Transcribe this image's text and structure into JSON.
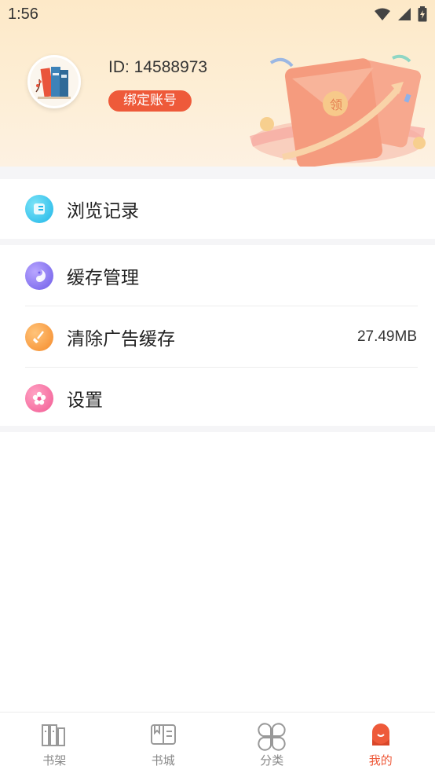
{
  "status_bar": {
    "time": "1:56"
  },
  "profile": {
    "id_text": "ID: 14588973",
    "bind_button": "绑定账号"
  },
  "menu": {
    "browse_history": {
      "label": "浏览记录"
    },
    "cache_manage": {
      "label": "缓存管理"
    },
    "clear_ad_cache": {
      "label": "清除广告缓存",
      "value": "27.49MB"
    },
    "settings": {
      "label": "设置"
    }
  },
  "bottom_nav": {
    "items": [
      {
        "label": "书架",
        "icon": "bookshelf-icon"
      },
      {
        "label": "书城",
        "icon": "book-store-icon"
      },
      {
        "label": "分类",
        "icon": "category-icon"
      },
      {
        "label": "我的",
        "icon": "profile-icon",
        "active": true
      }
    ]
  },
  "colors": {
    "accent": "#ee5a3a",
    "header_bg": "#fde9c8",
    "inactive": "#888888"
  }
}
